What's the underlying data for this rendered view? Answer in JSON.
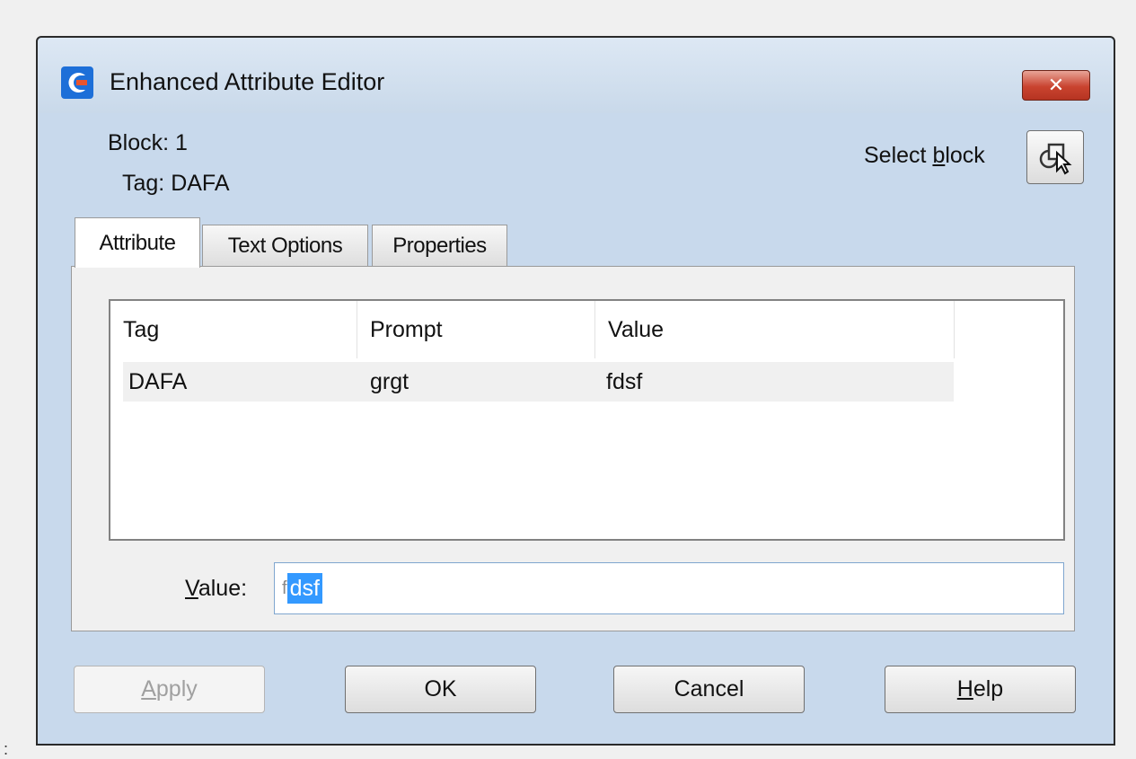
{
  "window": {
    "title": "Enhanced Attribute Editor",
    "close_glyph": "✕"
  },
  "info": {
    "block": "Block: 1",
    "tag": "Tag: DAFA"
  },
  "select_block": {
    "label_pre": "Select ",
    "label_mnemonic": "b",
    "label_post": "lock"
  },
  "tabs": [
    {
      "label": "Attribute",
      "active": true
    },
    {
      "label": "Text Options",
      "active": false
    },
    {
      "label": "Properties",
      "active": false
    }
  ],
  "attribute_list": {
    "headers": [
      "Tag",
      "Prompt",
      "Value"
    ],
    "rows": [
      {
        "tag": "DAFA",
        "prompt": "grgt",
        "value": "fdsf"
      }
    ]
  },
  "value_field": {
    "label_mnemonic": "V",
    "label_rest": "alue:",
    "caret_char": "f",
    "selected_text": "dsf"
  },
  "buttons": {
    "apply": {
      "mnemonic": "A",
      "rest": "pply",
      "enabled": false
    },
    "ok": {
      "label": "OK"
    },
    "cancel": {
      "label": "Cancel"
    },
    "help": {
      "mnemonic": "H",
      "rest": "elp"
    }
  },
  "edge_mark": ":",
  "colors": {
    "title_bar": "#c9d9ea",
    "close_button": "#c9432f",
    "selection": "#3399ff"
  }
}
